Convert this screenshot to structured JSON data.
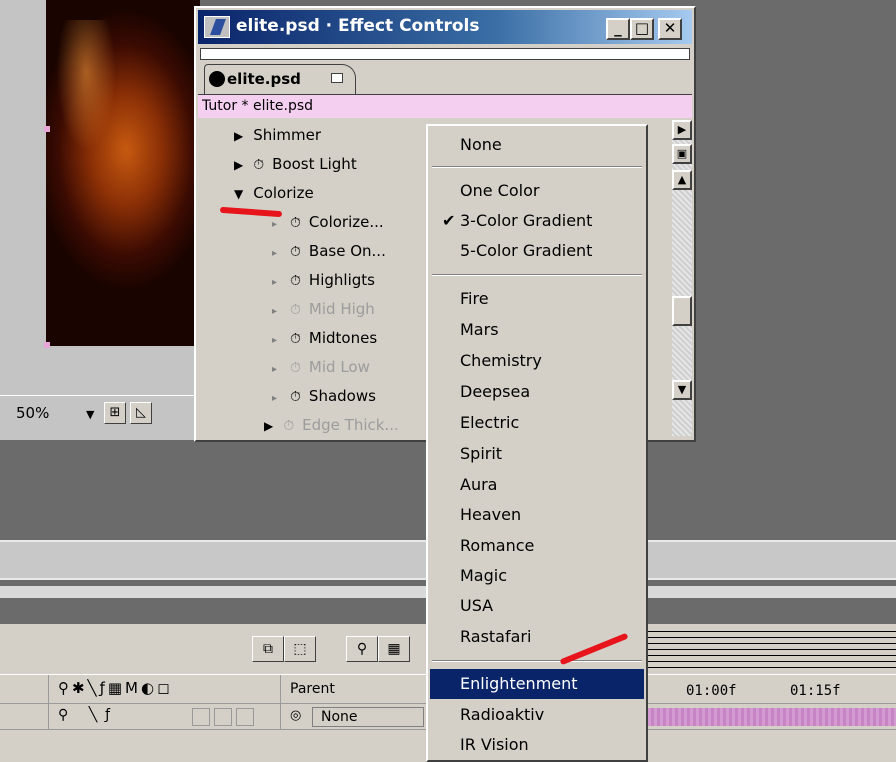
{
  "composition": {
    "zoom": "50%"
  },
  "effect_controls": {
    "window_title": "elite.psd · Effect Controls",
    "tab_label": "elite.psd",
    "layer_path": "Tutor * elite.psd",
    "properties": [
      "Shimmer",
      "Boost Light",
      "Colorize",
      "Colorize...",
      "Base On...",
      "Highligts",
      "Mid High",
      "Midtones",
      "Mid Low",
      "Shadows",
      "Edge Thick..."
    ]
  },
  "dropdown": {
    "items": [
      "None",
      "One Color",
      "3-Color Gradient",
      "5-Color Gradient",
      "Fire",
      "Mars",
      "Chemistry",
      "Deepsea",
      "Electric",
      "Spirit",
      "Aura",
      "Heaven",
      "Romance",
      "Magic",
      "USA",
      "Rastafari",
      "Enlightenment",
      "Radioaktiv",
      "IR Vision"
    ],
    "checked": "3-Color Gradient",
    "highlighted": "Enlightenment",
    "highlight_color": "#0a246a"
  },
  "timeline": {
    "parent_header": "Parent",
    "parent_value": "None",
    "time_markers": [
      "01:00f",
      "01:15f"
    ]
  },
  "colors": {
    "annotation_red": "#e8141b",
    "layer_bar_pink": "#f5cff0",
    "title_blue": "#0a246a"
  }
}
